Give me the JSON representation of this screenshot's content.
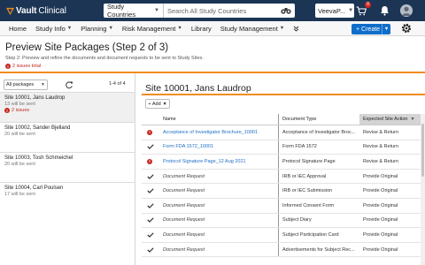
{
  "app": {
    "logo_name": "Vault",
    "logo_suffix": "Clinical",
    "search_scope": "Study Countries",
    "search_placeholder": "Search All Study Countries",
    "user_label": "VeevaP...",
    "cart_badge": "0"
  },
  "nav": {
    "items": [
      {
        "label": "Home",
        "has_menu": false
      },
      {
        "label": "Study Info",
        "has_menu": true
      },
      {
        "label": "Planning",
        "has_menu": true
      },
      {
        "label": "Risk Management",
        "has_menu": true
      },
      {
        "label": "Library",
        "has_menu": false
      },
      {
        "label": "Study Management",
        "has_menu": true
      }
    ],
    "create_label": "Create"
  },
  "page": {
    "title": "Preview Site Packages (Step 2 of 3)",
    "subtitle": "Step 2: Preview and refine the documents and document requests to be sent to Study Sites.",
    "issues_total": "2 issues total"
  },
  "left": {
    "filter_value": "All packages",
    "count": "1-4 of 4",
    "sites": [
      {
        "name": "Site 10001, Jans Laudrop",
        "sub": "13 will be sent",
        "issue": "2 issues",
        "selected": true
      },
      {
        "name": "Site 10002, Sander Bjelland",
        "sub": "20 will be sent",
        "issue": "",
        "selected": false
      },
      {
        "name": "Site 10003, Tosh Schmeichel",
        "sub": "20 will be sent",
        "issue": "",
        "selected": false
      },
      {
        "name": "Site 10004, Carl Poulsen",
        "sub": "17 will be sent",
        "issue": "",
        "selected": false
      }
    ]
  },
  "right": {
    "heading": "Site 10001, Jans Laudrop",
    "add_label": "Add",
    "columns": {
      "name": "Name",
      "type": "Document Type",
      "action": "Expected Site Action"
    },
    "rows": [
      {
        "status": "error",
        "name": "Acceptance of Investigator Brochure_10001",
        "kind": "link",
        "type": "Acceptance of Investigator Broc...",
        "action": "Revise & Return"
      },
      {
        "status": "ok",
        "name": "Form FDA 1572_10001",
        "kind": "link",
        "type": "Form FDA 1572",
        "action": "Revise & Return"
      },
      {
        "status": "error",
        "name": "Protocol Signature Page_12 Aug 2021",
        "kind": "link",
        "type": "Protocol Signature Page",
        "action": "Revise & Return"
      },
      {
        "status": "ok",
        "name": "Document Request",
        "kind": "request",
        "type": "IRB or IEC Approval",
        "action": "Provide Original"
      },
      {
        "status": "ok",
        "name": "Document Request",
        "kind": "request",
        "type": "IRB or IEC Submission",
        "action": "Provide Original"
      },
      {
        "status": "ok",
        "name": "Document Request",
        "kind": "request",
        "type": "Informed Consent Form",
        "action": "Provide Original"
      },
      {
        "status": "ok",
        "name": "Document Request",
        "kind": "request",
        "type": "Subject Diary",
        "action": "Provide Original"
      },
      {
        "status": "ok",
        "name": "Document Request",
        "kind": "request",
        "type": "Subject Participation Card",
        "action": "Provide Original"
      },
      {
        "status": "ok",
        "name": "Document Request",
        "kind": "request",
        "type": "Advertisements for Subject Rec...",
        "action": "Provide Original"
      }
    ]
  },
  "colors": {
    "topbar": "#1c3554",
    "accent": "#f08c1e",
    "create": "#0f6ec9",
    "error": "#c7281f",
    "link": "#1f6fc4"
  }
}
